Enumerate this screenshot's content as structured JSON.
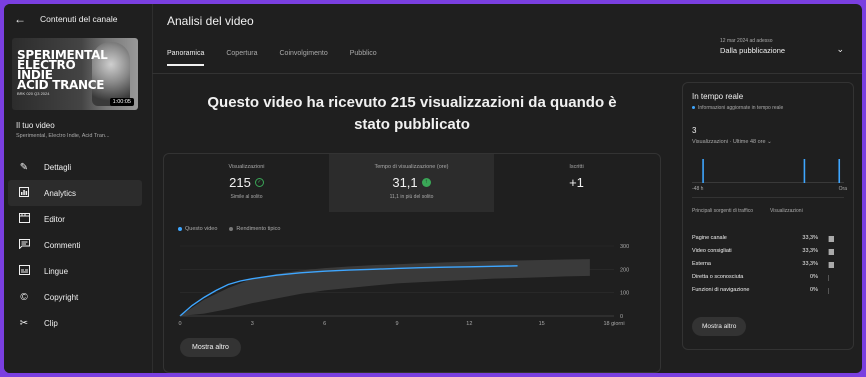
{
  "sidebar": {
    "back_label": "Contenuti del canale",
    "thumbnail": {
      "title_lines": [
        "SPERIMENTAL",
        "ELECTRO",
        "INDIE",
        "ACID TRANCE"
      ],
      "subtitle": "BRK 020 Q3 2024",
      "duration": "1:00:05"
    },
    "your_video_label": "Il tuo video",
    "video_subtitle": "Sperimental, Electro Indie, Acid Tran...",
    "items": [
      {
        "label": "Dettagli",
        "icon": "pencil-icon"
      },
      {
        "label": "Analytics",
        "icon": "analytics-icon",
        "active": true
      },
      {
        "label": "Editor",
        "icon": "editor-icon"
      },
      {
        "label": "Commenti",
        "icon": "comments-icon"
      },
      {
        "label": "Lingue",
        "icon": "subtitles-icon"
      },
      {
        "label": "Copyright",
        "icon": "copyright-icon"
      },
      {
        "label": "Clip",
        "icon": "scissors-icon"
      }
    ]
  },
  "header": {
    "title": "Analisi del video",
    "tabs": [
      "Panoramica",
      "Copertura",
      "Coinvolgimento",
      "Pubblico"
    ],
    "active_tab": 0,
    "date_range": "12 mar 2024 ad adesso",
    "date_label": "Dalla pubblicazione"
  },
  "headline": "Questo video ha ricevuto 215 visualizzazioni da quando è stato pubblicato",
  "metrics": [
    {
      "label": "Visualizzazioni",
      "value": "215",
      "sub": "Simile al solito",
      "indicator": "check"
    },
    {
      "label": "Tempo di visualizzazione (ore)",
      "value": "31,1",
      "sub": "11,1 in più del solito",
      "indicator": "up"
    },
    {
      "label": "Iscritti",
      "value": "+1",
      "sub": ""
    }
  ],
  "chart_legend": {
    "this_video": "Questo video",
    "typical": "Rendimento tipico"
  },
  "chart_data": {
    "type": "line",
    "x_ticks": [
      "0",
      "3",
      "6",
      "9",
      "12",
      "15",
      "18 giorni"
    ],
    "y_ticks": [
      "0",
      "100",
      "200",
      "300"
    ],
    "ylim": [
      0,
      300
    ],
    "xlim": [
      0,
      18
    ],
    "series": [
      {
        "name": "Questo video",
        "x": [
          0,
          0.5,
          1,
          1.5,
          2,
          2.5,
          3,
          4,
          5,
          6,
          7,
          8,
          9,
          10,
          11,
          12,
          13,
          14
        ],
        "y": [
          0,
          45,
          80,
          110,
          135,
          150,
          160,
          175,
          185,
          192,
          197,
          200,
          204,
          207,
          209,
          211,
          213,
          215
        ]
      },
      {
        "name": "Rendimento tipico",
        "x": [
          0,
          1,
          2,
          3,
          4,
          5,
          6,
          7,
          8,
          9,
          10,
          11,
          12,
          13,
          14,
          15,
          16,
          17
        ],
        "low": [
          0,
          10,
          30,
          55,
          75,
          95,
          110,
          120,
          130,
          140,
          145,
          150,
          155,
          160,
          163,
          166,
          170,
          172
        ],
        "high": [
          0,
          70,
          120,
          160,
          180,
          195,
          205,
          212,
          218,
          222,
          226,
          230,
          233,
          236,
          238,
          240,
          242,
          244
        ]
      }
    ],
    "colors": {
      "line": "#3ea6ff",
      "band": "#3a3a3a"
    }
  },
  "more_button": "Mostra altro",
  "realtime": {
    "title": "In tempo reale",
    "subtitle": "Informazioni aggiornate in tempo reale",
    "count": "3",
    "count_label": "Visualizzazioni · Ultime 48 ore",
    "axis_left": "-48 h",
    "axis_right": "Ora",
    "bars": [
      0,
      0,
      0,
      1,
      0,
      0,
      0,
      0,
      0,
      0,
      0,
      0,
      0,
      0,
      0,
      0,
      0,
      0,
      0,
      0,
      0,
      0,
      0,
      0,
      0,
      0,
      0,
      0,
      0,
      0,
      0,
      0,
      0,
      0,
      0,
      1,
      0,
      0,
      0,
      0,
      0,
      0,
      0,
      0,
      0,
      0,
      1,
      0
    ],
    "sources_header": "Principali sorgenti di traffico",
    "views_header": "Visualizzazioni",
    "sources": [
      {
        "name": "Pagine canale",
        "pct": "33,3%",
        "value": 0.333
      },
      {
        "name": "Video consigliati",
        "pct": "33,3%",
        "value": 0.333
      },
      {
        "name": "Esterna",
        "pct": "33,3%",
        "value": 0.333
      },
      {
        "name": "Diretta o sconosciuta",
        "pct": "0%",
        "value": 0
      },
      {
        "name": "Funzioni di navigazione",
        "pct": "0%",
        "value": 0
      }
    ],
    "more_button": "Mostra altro"
  }
}
